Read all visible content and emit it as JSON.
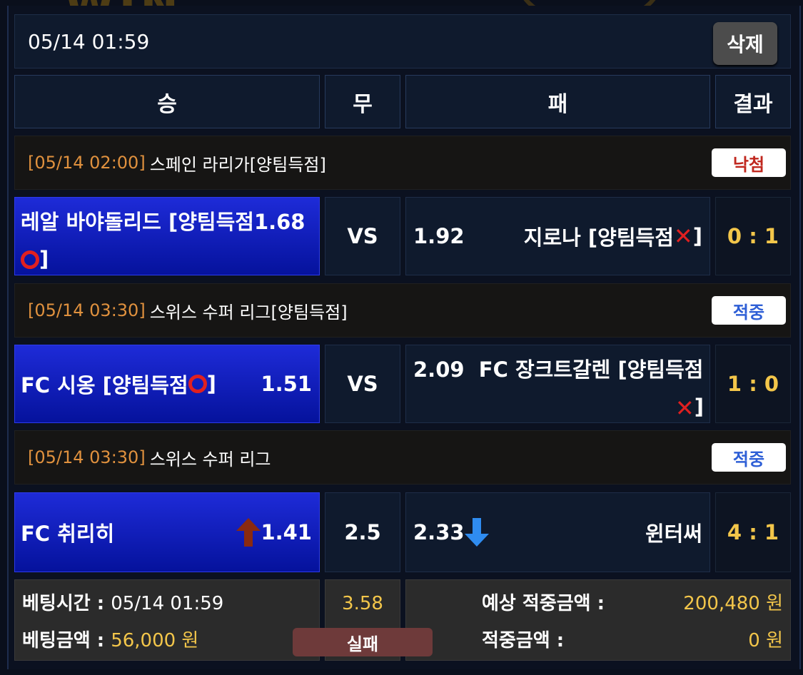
{
  "header": {
    "datetime": "05/14 01:59",
    "delete_label": "삭제"
  },
  "columns": {
    "win": "승",
    "draw": "무",
    "lose": "패",
    "result": "결과"
  },
  "matches": [
    {
      "time": "[05/14 02:00]",
      "league": "스페인 라리가[양팀득점]",
      "badge": "낙첨",
      "badge_color": "#c0281f",
      "home_team": "레알 바야돌리드 [양팀득점",
      "home_suffix": "]",
      "home_odds": "1.68",
      "mid": "VS",
      "away_odds": "1.92",
      "away_team": "지로나 [양팀득점",
      "away_suffix": "]",
      "score": "0 : 1"
    },
    {
      "time": "[05/14 03:30]",
      "league": "스위스 수퍼 리그[양팀득점]",
      "badge": "적중",
      "badge_color": "#2e5fd6",
      "home_team": "FC 시옹 [양팀득점",
      "home_suffix": "]",
      "home_odds": "1.51",
      "mid": "VS",
      "away_odds": "2.09",
      "away_team": "FC 장크트갈렌 [양팀득점",
      "away_suffix": "]",
      "score": "1 : 0"
    },
    {
      "time": "[05/14 03:30]",
      "league": "스위스 수퍼 리그",
      "badge": "적중",
      "badge_color": "#2e5fd6",
      "home_team": "FC 취리히",
      "home_odds": "1.41",
      "mid": "2.5",
      "away_odds": "2.33",
      "away_team": "윈터써",
      "score": "4 : 1"
    }
  ],
  "footer": {
    "bet_time_label": "베팅시간 : ",
    "bet_time": "05/14 01:59",
    "bet_amount_label": "베팅금액 : ",
    "bet_amount": "56,000 원",
    "total_odds": "3.58",
    "status": "실패",
    "expected_label": "예상 적중금액 :",
    "expected_value": "200,480 원",
    "won_label": "적중금액 :",
    "won_value": "0 원"
  },
  "colors": {
    "accent_orange": "#e0913e",
    "gold": "#f3c64a",
    "home_blue": "#1424c8",
    "fail_bg": "#6e3a3a"
  },
  "icons": {
    "hit": "red-circle-icon",
    "miss": "red-x-icon",
    "up": "arrow-up-icon",
    "down": "arrow-down-icon"
  }
}
